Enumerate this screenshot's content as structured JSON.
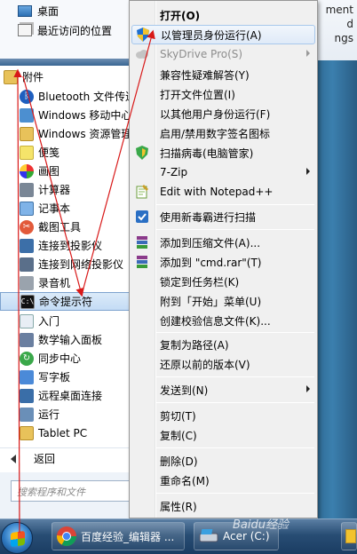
{
  "background_window": {
    "lines": [
      "ment",
      "d",
      "ngs"
    ]
  },
  "start_menu": {
    "top_items": [
      {
        "label": "桌面",
        "icon": "desktop-icon"
      },
      {
        "label": "最近访问的位置",
        "icon": "recent-places-icon"
      }
    ],
    "folder": {
      "label": "附件",
      "icon": "folder-icon"
    },
    "programs": [
      {
        "label": "Bluetooth 文件传送",
        "icon": "bluetooth-icon"
      },
      {
        "label": "Windows 移动中心",
        "icon": "mobility-center-icon"
      },
      {
        "label": "Windows 资源管理器",
        "icon": "explorer-icon"
      },
      {
        "label": "便笺",
        "icon": "sticky-notes-icon"
      },
      {
        "label": "画图",
        "icon": "paint-icon"
      },
      {
        "label": "计算器",
        "icon": "calculator-icon"
      },
      {
        "label": "记事本",
        "icon": "notepad-icon"
      },
      {
        "label": "截图工具",
        "icon": "snipping-tool-icon"
      },
      {
        "label": "连接到投影仪",
        "icon": "projector-icon"
      },
      {
        "label": "连接到网络投影仪",
        "icon": "network-projector-icon"
      },
      {
        "label": "录音机",
        "icon": "sound-recorder-icon"
      },
      {
        "label": "命令提示符",
        "icon": "command-prompt-icon",
        "selected": true
      },
      {
        "label": "入门",
        "icon": "getting-started-icon"
      },
      {
        "label": "数学输入面板",
        "icon": "math-input-icon"
      },
      {
        "label": "同步中心",
        "icon": "sync-center-icon"
      },
      {
        "label": "写字板",
        "icon": "wordpad-icon"
      },
      {
        "label": "远程桌面连接",
        "icon": "remote-desktop-icon"
      },
      {
        "label": "运行",
        "icon": "run-icon"
      },
      {
        "label": "Tablet PC",
        "icon": "folder-icon"
      }
    ],
    "back_label": "返回",
    "search_placeholder": "搜索程序和文件"
  },
  "context_menu": {
    "items": [
      {
        "label": "打开(O)",
        "bold": true
      },
      {
        "label": "以管理员身份运行(A)",
        "icon": "uac-shield-icon",
        "hover": true
      },
      {
        "label": "SkyDrive Pro(S)",
        "icon": "skydrive-icon",
        "disabled": true,
        "submenu": true
      },
      {
        "label": "兼容性疑难解答(Y)"
      },
      {
        "label": "打开文件位置(I)"
      },
      {
        "label": "以其他用户身份运行(F)"
      },
      {
        "label": "启用/禁用数字签名图标"
      },
      {
        "label": "扫描病毒(电脑管家)",
        "icon": "antivirus-shield-icon"
      },
      {
        "label": "7-Zip",
        "submenu": true
      },
      {
        "label": "Edit with Notepad++",
        "icon": "notepadpp-icon"
      },
      {
        "label": "使用新毒霸进行扫描",
        "icon": "duba-icon"
      },
      {
        "label": "添加到压缩文件(A)...",
        "icon": "winrar-icon"
      },
      {
        "label": "添加到 \"cmd.rar\"(T)",
        "icon": "winrar-icon"
      },
      {
        "label": "锁定到任务栏(K)"
      },
      {
        "label": "附到「开始」菜单(U)"
      },
      {
        "label": "创建校验信息文件(K)..."
      },
      {
        "label": "复制为路径(A)"
      },
      {
        "label": "还原以前的版本(V)"
      },
      {
        "label": "发送到(N)",
        "submenu": true
      },
      {
        "label": "剪切(T)"
      },
      {
        "label": "复制(C)"
      },
      {
        "label": "删除(D)"
      },
      {
        "label": "重命名(M)"
      },
      {
        "label": "属性(R)"
      }
    ]
  },
  "taskbar": {
    "buttons": [
      {
        "label": "百度经验_编辑器 ...",
        "icon": "chrome-icon"
      },
      {
        "label": "Acer (C:)",
        "icon": "drive-icon"
      }
    ]
  },
  "watermark": "Baidu经验"
}
